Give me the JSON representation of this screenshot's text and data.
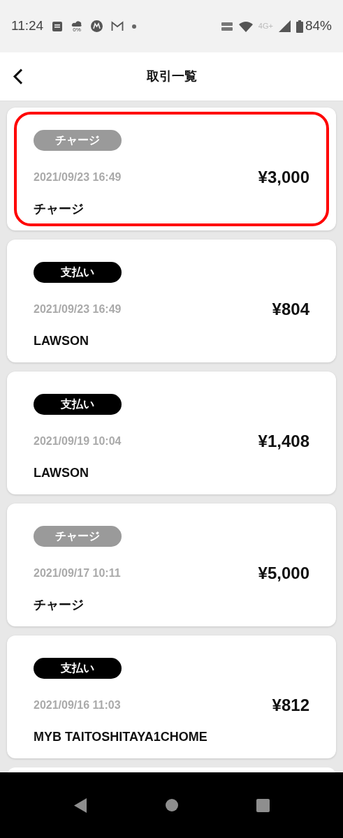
{
  "status_bar": {
    "time": "11:24",
    "weather_label": "0%",
    "network": "4G+",
    "battery": "84%"
  },
  "header": {
    "title": "取引一覧"
  },
  "transactions": [
    {
      "kind": "charge",
      "tag": "チャージ",
      "date": "2021/09/23 16:49",
      "amount": "¥3,000",
      "name": "チャージ",
      "highlighted": true
    },
    {
      "kind": "payment",
      "tag": "支払い",
      "date": "2021/09/23 16:49",
      "amount": "¥804",
      "name": "LAWSON",
      "highlighted": false
    },
    {
      "kind": "payment",
      "tag": "支払い",
      "date": "2021/09/19 10:04",
      "amount": "¥1,408",
      "name": "LAWSON",
      "highlighted": false
    },
    {
      "kind": "charge",
      "tag": "チャージ",
      "date": "2021/09/17 10:11",
      "amount": "¥5,000",
      "name": "チャージ",
      "highlighted": false
    },
    {
      "kind": "payment",
      "tag": "支払い",
      "date": "2021/09/16 11:03",
      "amount": "¥812",
      "name": "MYB TAITOSHITAYA1CHOME",
      "highlighted": false
    }
  ],
  "more_below": true
}
